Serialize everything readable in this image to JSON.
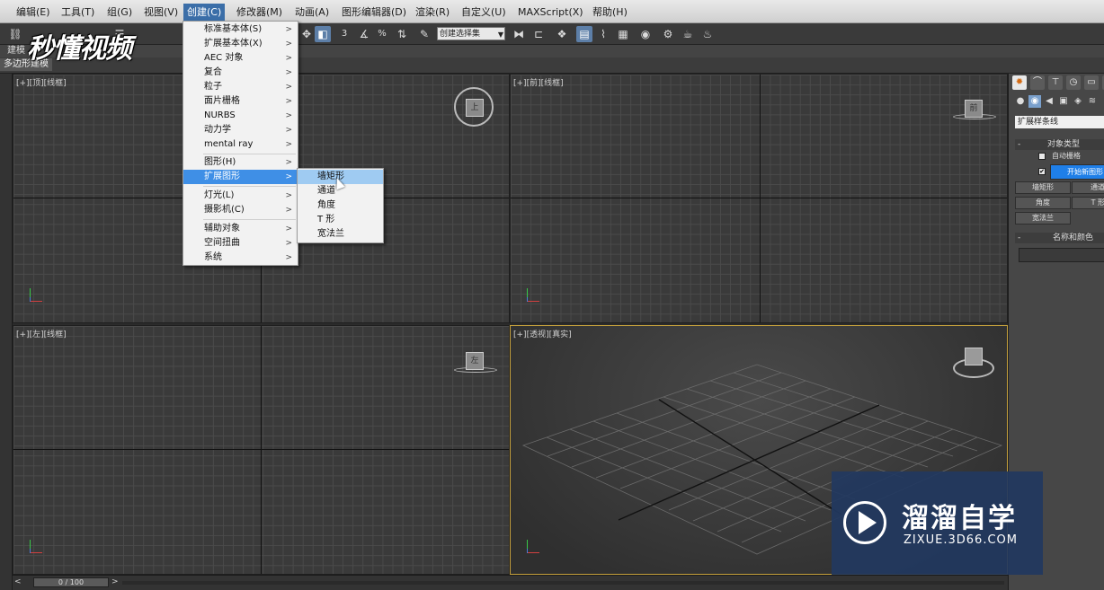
{
  "menubar": {
    "items": [
      {
        "label": "编辑(E)"
      },
      {
        "label": "工具(T)"
      },
      {
        "label": "组(G)"
      },
      {
        "label": "视图(V)"
      },
      {
        "label": "创建(C)",
        "active": true
      },
      {
        "label": "修改器(M)"
      },
      {
        "label": "动画(A)"
      },
      {
        "label": "图形编辑器(D)"
      },
      {
        "label": "渲染(R)"
      },
      {
        "label": "自定义(U)"
      },
      {
        "label": "MAXScript(X)"
      },
      {
        "label": "帮助(H)"
      }
    ]
  },
  "toolbar": {
    "selection_set": "创建选择集",
    "snap_num": "3"
  },
  "ribbon": {
    "tab": "建模",
    "subtab": "多边形建模"
  },
  "create_menu": {
    "items": [
      {
        "label": "标准基本体(S)",
        "submenu": true
      },
      {
        "label": "扩展基本体(X)",
        "submenu": true
      },
      {
        "label": "AEC 对象",
        "submenu": true
      },
      {
        "label": "复合",
        "submenu": true
      },
      {
        "label": "粒子",
        "submenu": true
      },
      {
        "label": "面片栅格",
        "submenu": true
      },
      {
        "label": "NURBS",
        "submenu": true
      },
      {
        "label": "动力学",
        "submenu": true
      },
      {
        "label": "mental ray",
        "submenu": true
      },
      {
        "label": "图形(H)",
        "submenu": true
      },
      {
        "label": "扩展图形",
        "submenu": true,
        "highlighted": true
      },
      {
        "label": "灯光(L)",
        "submenu": true
      },
      {
        "label": "摄影机(C)",
        "submenu": true
      },
      {
        "label": "辅助对象",
        "submenu": true
      },
      {
        "label": "空间扭曲",
        "submenu": true
      },
      {
        "label": "系统",
        "submenu": true
      }
    ]
  },
  "extended_shapes_menu": {
    "items": [
      {
        "label": "墙矩形",
        "highlighted": true
      },
      {
        "label": "通道"
      },
      {
        "label": "角度"
      },
      {
        "label": "T 形"
      },
      {
        "label": "宽法兰"
      }
    ]
  },
  "viewports": {
    "top": {
      "label": "[+][顶][线框]"
    },
    "front": {
      "label": "[+][前][线框]"
    },
    "left": {
      "label": "[+][左][线框]"
    },
    "perspective": {
      "label": "[+][透视][真实]"
    }
  },
  "viewcube": {
    "top_face": "上",
    "front_face": "前",
    "left_face": "左"
  },
  "command_panel": {
    "category_dropdown": "扩展样条线",
    "object_type_rollout": "对象类型",
    "autogrid_label": "自动栅格",
    "start_new_shape_label": "开始新图形",
    "buttons": [
      "墙矩形",
      "通道",
      "角度",
      "T 形",
      "宽法兰"
    ],
    "name_color_rollout": "名称和颜色"
  },
  "timeline": {
    "frame": "0 / 100"
  },
  "watermarks": {
    "top_left": "秒懂视频",
    "bottom_right_title": "溜溜自学",
    "bottom_right_url": "ZIXUE.3D66.COM"
  }
}
